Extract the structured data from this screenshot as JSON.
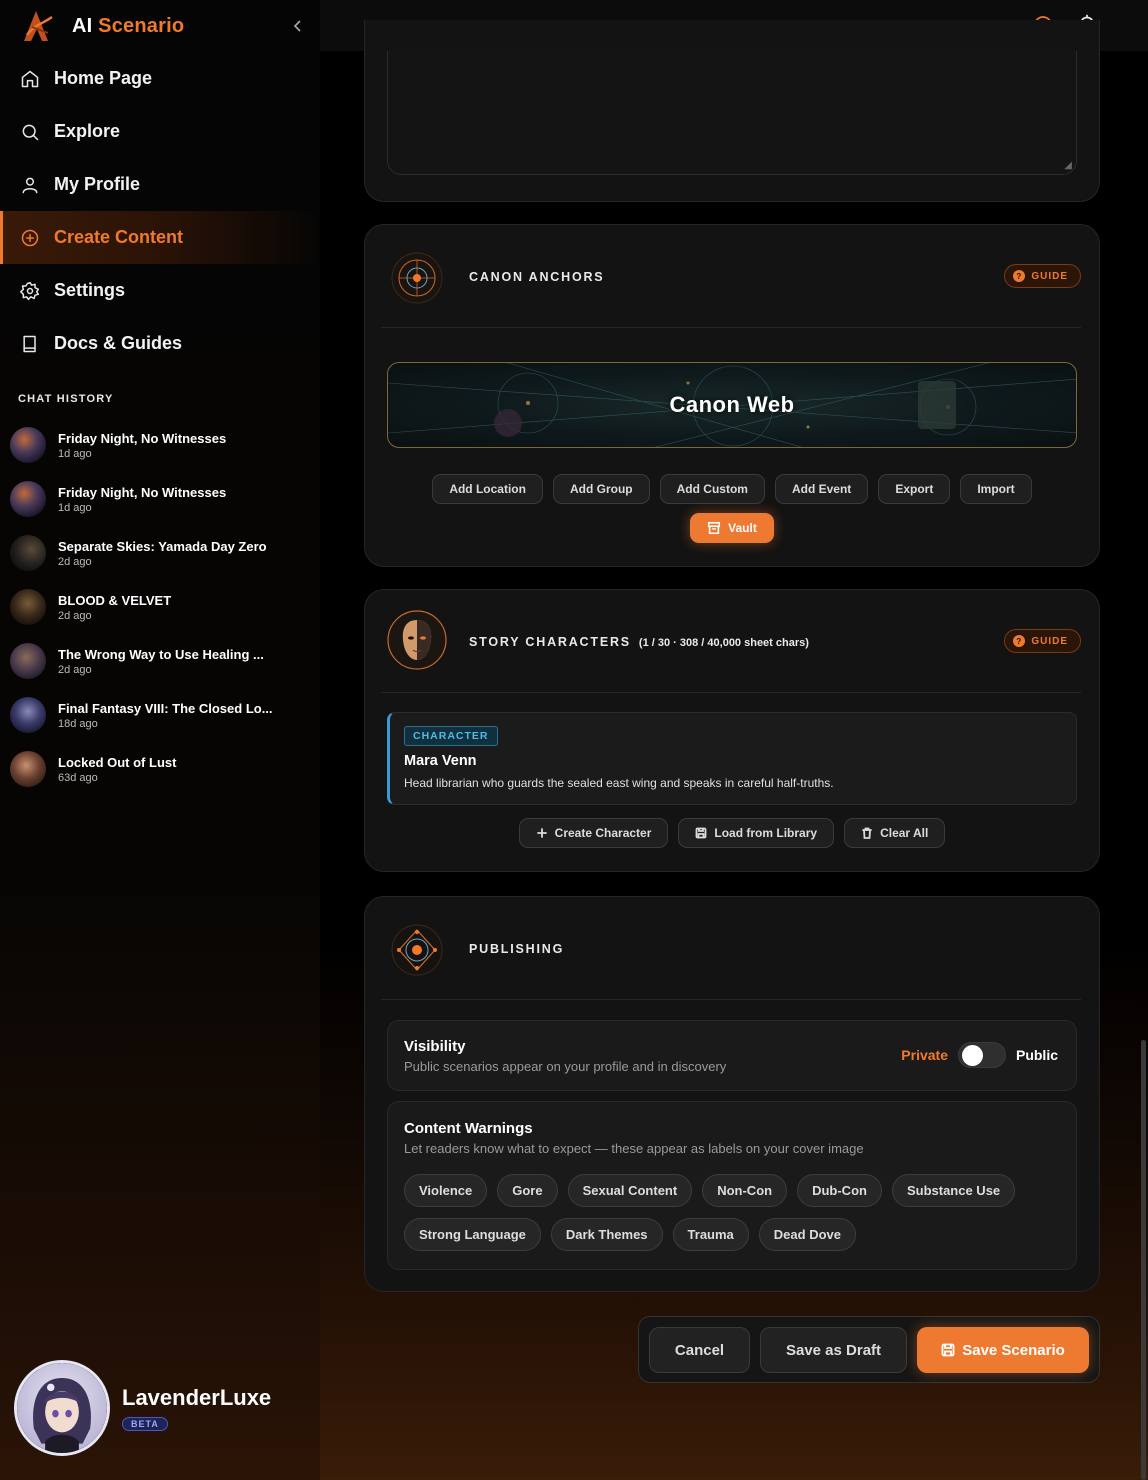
{
  "brand": {
    "name_part1": "AI",
    "name_part2": "Scenario"
  },
  "nav": {
    "items": [
      {
        "label": "Home Page",
        "icon": "home-icon"
      },
      {
        "label": "Explore",
        "icon": "search-icon"
      },
      {
        "label": "My Profile",
        "icon": "user-icon"
      },
      {
        "label": "Create Content",
        "icon": "plus-circle-icon",
        "active": true
      },
      {
        "label": "Settings",
        "icon": "gear-icon"
      },
      {
        "label": "Docs & Guides",
        "icon": "book-icon"
      }
    ]
  },
  "chat_history": {
    "title": "CHAT HISTORY",
    "items": [
      {
        "title": "Friday Night, No Witnesses",
        "time": "1d ago"
      },
      {
        "title": "Friday Night, No Witnesses",
        "time": "1d ago"
      },
      {
        "title": "Separate Skies: Yamada Day Zero",
        "time": "2d ago"
      },
      {
        "title": "BLOOD & VELVET",
        "time": "2d ago"
      },
      {
        "title": "The Wrong Way to Use Healing ...",
        "time": "2d ago"
      },
      {
        "title": "Final Fantasy VIII: The Closed Lo...",
        "time": "18d ago"
      },
      {
        "title": "Locked Out of Lust",
        "time": "63d ago"
      }
    ]
  },
  "user": {
    "name": "LavenderLuxe",
    "badge": "BETA"
  },
  "canon": {
    "title": "CANON ANCHORS",
    "guide": "GUIDE",
    "web_title": "Canon Web",
    "buttons": [
      "Add Location",
      "Add Group",
      "Add Custom",
      "Add Event",
      "Export",
      "Import"
    ],
    "vault": "Vault"
  },
  "characters": {
    "title": "STORY CHARACTERS",
    "subtitle": "(1 / 30 · 308 / 40,000 sheet chars)",
    "guide": "GUIDE",
    "card": {
      "tag": "CHARACTER",
      "name": "Mara Venn",
      "desc": "Head librarian who guards the sealed east wing and speaks in careful half-truths."
    },
    "buttons": {
      "create": "Create Character",
      "load": "Load from Library",
      "clear": "Clear All"
    }
  },
  "publishing": {
    "title": "PUBLISHING",
    "visibility": {
      "title": "Visibility",
      "sub": "Public scenarios appear on your profile and in discovery",
      "private_label": "Private",
      "public_label": "Public"
    },
    "warnings": {
      "title": "Content Warnings",
      "sub": "Let readers know what to expect — these appear as labels on your cover image",
      "items": [
        "Violence",
        "Gore",
        "Sexual Content",
        "Non-Con",
        "Dub-Con",
        "Substance Use",
        "Strong Language",
        "Dark Themes",
        "Trauma",
        "Dead Dove"
      ]
    }
  },
  "actions": {
    "cancel": "Cancel",
    "draft": "Save as Draft",
    "save": "Save Scenario"
  },
  "colors": {
    "accent": "#f07a2c",
    "background": "#000000",
    "card": "#131313",
    "character_tag": "#52b8e4"
  }
}
